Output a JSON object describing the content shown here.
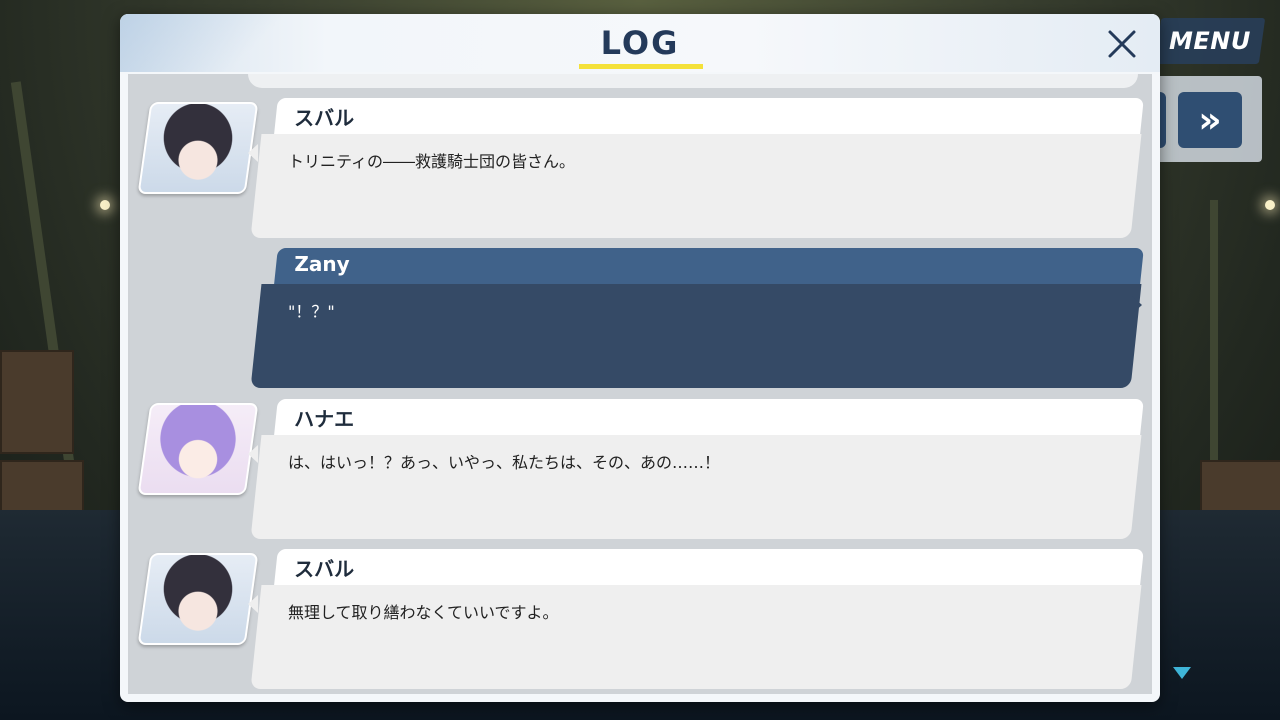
{
  "window": {
    "title": "LOG",
    "close_icon": "close-x-icon"
  },
  "hud": {
    "menu_label": "MENU",
    "skip_icon": "fast-forward-icon",
    "skip_glyph": "»",
    "scroll_icon": "scroll-down-triangle-icon"
  },
  "entries": [
    {
      "speaker": "スバル",
      "text": "トリニティの――救護騎士団の皆さん。",
      "portrait_icon": "subaru-portrait"
    },
    {
      "speaker": "Zany",
      "text": "\"！？\"",
      "is_player": true
    },
    {
      "speaker": "ハナエ",
      "text": "は、はいっ！？あっ、いやっ、私たちは、その、あの……！",
      "portrait_icon": "hanae-portrait"
    },
    {
      "speaker": "スバル",
      "text": "無理して取り繕わなくていいですよ。",
      "portrait_icon": "subaru-portrait"
    }
  ],
  "colors": {
    "title_text": "#243a5a",
    "title_underline": "#f4e13a",
    "player_name_bar": "#40628a",
    "player_message": "#354a66",
    "npc_name_bar": "#ffffff",
    "npc_message": "#efefef",
    "menu_button": "#283e58",
    "scroll_arrow": "#3fb5d8"
  }
}
